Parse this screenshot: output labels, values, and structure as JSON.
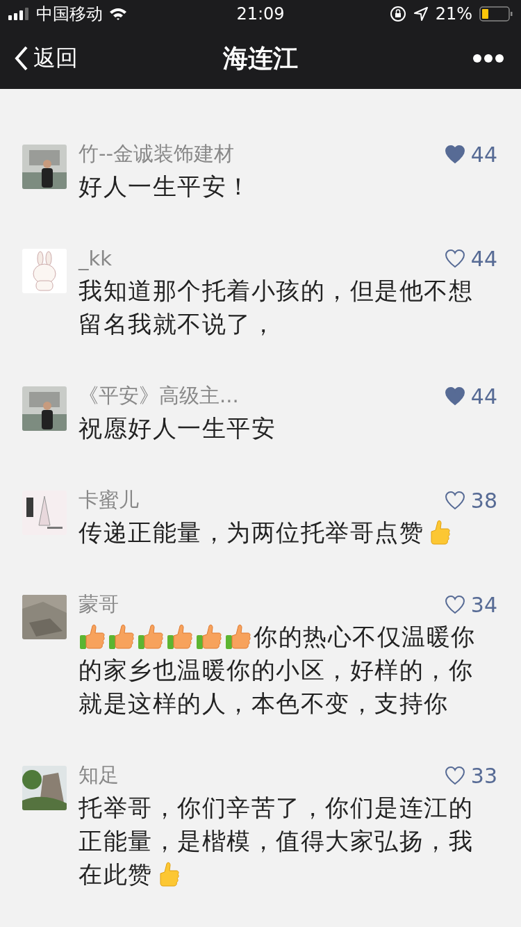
{
  "status_bar": {
    "carrier": "中国移动",
    "time": "21:09",
    "battery": "21%"
  },
  "nav": {
    "back": "返回",
    "title": "海连江"
  },
  "comments": [
    {
      "name": "竹--金诚装饰建材",
      "likes": "44",
      "liked": true,
      "lines": [
        [
          {
            "kind": "text",
            "text": "好人一生平安！"
          }
        ]
      ]
    },
    {
      "name": "_kk",
      "likes": "44",
      "liked": false,
      "lines": [
        [
          {
            "kind": "text",
            "text": "我知道那个托着小孩的，但是他不想"
          }
        ],
        [
          {
            "kind": "text",
            "text": "留名我就不说了，"
          }
        ]
      ]
    },
    {
      "name": "《平安》高级主...",
      "likes": "44",
      "liked": true,
      "lines": [
        [
          {
            "kind": "text",
            "text": "祝愿好人一生平安"
          }
        ]
      ]
    },
    {
      "name": "卡蜜儿",
      "likes": "38",
      "liked": false,
      "lines": [
        [
          {
            "kind": "text",
            "text": "传递正能量，为两位托举哥点赞"
          },
          {
            "kind": "emoji"
          }
        ]
      ]
    },
    {
      "name": "蒙哥",
      "likes": "34",
      "liked": false,
      "lines": [
        [
          {
            "kind": "sticker"
          },
          {
            "kind": "sticker"
          },
          {
            "kind": "sticker"
          },
          {
            "kind": "sticker"
          },
          {
            "kind": "sticker"
          },
          {
            "kind": "sticker"
          },
          {
            "kind": "text",
            "text": "你的热心不仅温暖你"
          }
        ],
        [
          {
            "kind": "text",
            "text": "的家乡也温暖你的小区，好样的，你"
          }
        ],
        [
          {
            "kind": "text",
            "text": "就是这样的人，本色不变，支持你"
          }
        ]
      ]
    },
    {
      "name": "知足",
      "likes": "33",
      "liked": false,
      "lines": [
        [
          {
            "kind": "text",
            "text": "托举哥，你们辛苦了，你们是连江的"
          }
        ],
        [
          {
            "kind": "text",
            "text": "正能量，是楷模，值得大家弘扬，我"
          }
        ],
        [
          {
            "kind": "text",
            "text": "在此赞"
          },
          {
            "kind": "emoji"
          }
        ]
      ]
    }
  ]
}
